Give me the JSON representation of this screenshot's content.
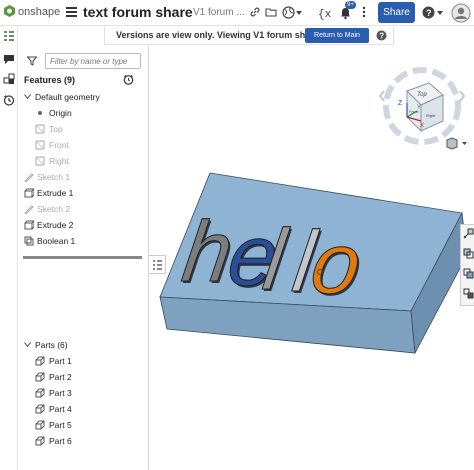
{
  "app": {
    "brand": "onshape"
  },
  "header": {
    "doc_title": "text forum share",
    "version_name": "V1 forum ...",
    "notif_count": "9+",
    "share_label": "Share",
    "help_menu": "?",
    "icons": [
      "link-icon",
      "folder-icon",
      "globe-icon",
      "variables-icon",
      "notifications-icon",
      "more-icon",
      "help-icon",
      "user-avatar"
    ]
  },
  "banner": {
    "text": "Versions are view only. Viewing V1 forum sh...",
    "return_label": "Return to Main"
  },
  "feature_panel": {
    "filter_placeholder": "Filter by name or type",
    "features_header": "Features (9)",
    "items": [
      {
        "label": "Default geometry",
        "icon": "chevron-down-icon",
        "state": "normal"
      },
      {
        "label": "Origin",
        "icon": "origin-dot-icon",
        "state": "normal"
      },
      {
        "label": "Top",
        "icon": "plane-icon",
        "state": "muted"
      },
      {
        "label": "Front",
        "icon": "plane-icon",
        "state": "muted"
      },
      {
        "label": "Right",
        "icon": "plane-icon",
        "state": "muted"
      },
      {
        "label": "Sketch 1",
        "icon": "sketch-icon",
        "state": "muted"
      },
      {
        "label": "Extrude 1",
        "icon": "extrude-icon",
        "state": "normal"
      },
      {
        "label": "Sketch 2",
        "icon": "sketch-icon",
        "state": "muted"
      },
      {
        "label": "Extrude 2",
        "icon": "extrude-icon",
        "state": "normal"
      },
      {
        "label": "Boolean 1",
        "icon": "boolean-icon",
        "state": "normal"
      }
    ],
    "parts_header": "Parts (6)",
    "parts": [
      "Part 1",
      "Part 2",
      "Part 3",
      "Part 4",
      "Part 5",
      "Part 6"
    ]
  },
  "view_cube": {
    "face_top": "Top",
    "face_front": "Front",
    "face_right": "Right",
    "axis_x": "X",
    "axis_y": "Y",
    "axis_z": "Z"
  },
  "model": {
    "text": "hello",
    "letter_colors": [
      "#7d7d7d",
      "#2b4e9a",
      "#9a9a9a",
      "#c2c6cc",
      "#e0790f"
    ],
    "block_color": "#8fb3d3"
  },
  "colors": {
    "accent": "#2a5db0",
    "logo_green": "#5a9a3a"
  }
}
